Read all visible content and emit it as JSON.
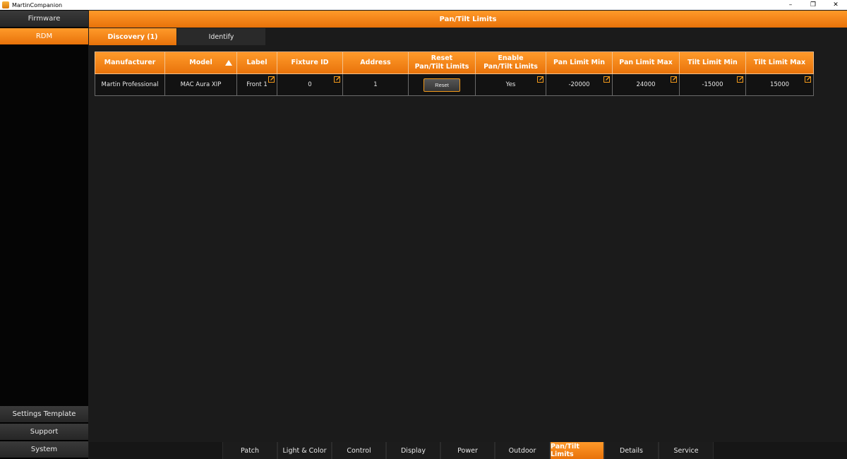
{
  "window": {
    "title": "MartinCompanion",
    "controls": {
      "minimize": "–",
      "restore": "❐",
      "close": "✕"
    }
  },
  "sidebar": {
    "top": [
      {
        "label": "Firmware",
        "active": false
      },
      {
        "label": "RDM",
        "active": true
      }
    ],
    "bottom": [
      {
        "label": "Settings Template"
      },
      {
        "label": "Support"
      },
      {
        "label": "System"
      }
    ]
  },
  "header": {
    "title": "Pan/Tilt Limits"
  },
  "tabs": [
    {
      "label": "Discovery (1)",
      "active": true
    },
    {
      "label": "Identify",
      "active": false
    }
  ],
  "table": {
    "columns": [
      {
        "label": "Manufacturer",
        "editable": false
      },
      {
        "label": "Model",
        "editable": false,
        "sorted": true
      },
      {
        "label": "Label",
        "editable": true
      },
      {
        "label": "Fixture ID",
        "editable": true
      },
      {
        "label": "Address",
        "editable": false
      },
      {
        "label": "Reset\nPan/Tilt Limits",
        "editable": false
      },
      {
        "label": "Enable\nPan/Tilt Limits",
        "editable": true
      },
      {
        "label": "Pan Limit Min",
        "editable": true
      },
      {
        "label": "Pan Limit Max",
        "editable": true
      },
      {
        "label": "Tilt Limit Min",
        "editable": true
      },
      {
        "label": "Tilt Limit Max",
        "editable": true
      }
    ],
    "rows": [
      {
        "manufacturer": "Martin Professional",
        "model": "MAC Aura XIP",
        "label": "Front 1",
        "fixture_id": "0",
        "address": "1",
        "reset_label": "Reset",
        "enable": "Yes",
        "pan_min": "-20000",
        "pan_max": "24000",
        "tilt_min": "-15000",
        "tilt_max": "15000"
      }
    ]
  },
  "bottom_tabs": [
    {
      "label": "Patch",
      "active": false
    },
    {
      "label": "Light & Color",
      "active": false
    },
    {
      "label": "Control",
      "active": false
    },
    {
      "label": "Display",
      "active": false
    },
    {
      "label": "Power",
      "active": false
    },
    {
      "label": "Outdoor",
      "active": false
    },
    {
      "label": "Pan/Tilt Limits",
      "active": true
    },
    {
      "label": "Details",
      "active": false
    },
    {
      "label": "Service",
      "active": false
    }
  ],
  "colors": {
    "accent": "#f39a1b",
    "background": "#1b1b1b",
    "sidebar": "#050505"
  },
  "icons": {
    "edit": "edit-pencil-icon",
    "sort": "sort-ascending-icon",
    "app": "app-icon"
  }
}
